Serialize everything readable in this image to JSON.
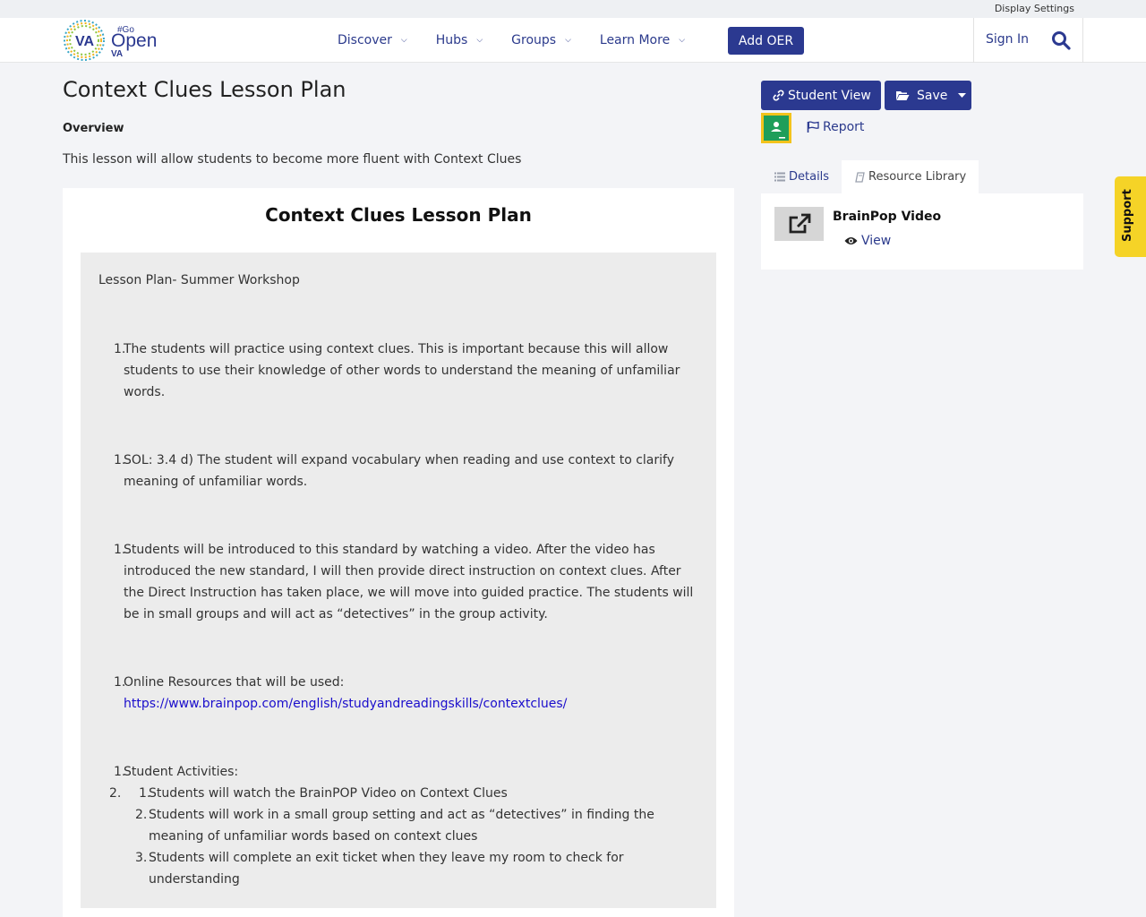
{
  "topbar": {
    "display_settings": "Display Settings"
  },
  "header": {
    "logo": {
      "text_va": "VA",
      "text_go": "#Go",
      "text_open": "Open",
      "text_va2": "VA"
    },
    "nav": [
      {
        "label": "Discover"
      },
      {
        "label": "Hubs"
      },
      {
        "label": "Groups"
      },
      {
        "label": "Learn More"
      }
    ],
    "add_oer": "Add OER",
    "sign_in": "Sign In"
  },
  "page": {
    "title": "Context Clues Lesson Plan",
    "overview_label": "Overview",
    "overview_text": "This lesson will allow students to become more fluent with Context Clues"
  },
  "content": {
    "heading": "Context Clues Lesson Plan",
    "lesson_label": "Lesson Plan- Summer Workshop",
    "items": [
      {
        "num": "1.",
        "text": "The students will practice using context clues. This is important because this will allow students to use their knowledge of other words to understand the meaning of unfamiliar words."
      },
      {
        "num": "1.",
        "text": "SOL: 3.4 d) The student will expand vocabulary when reading and use context to clarify meaning of unfamiliar words."
      },
      {
        "num": "1.",
        "text": "Students will be introduced to this standard by watching a video. After the video has introduced the new standard, I will then provide direct instruction on context clues. After the Direct Instruction has taken place, we will move into guided practice. The students will be in small groups and will act as “detectives” in the group activity."
      },
      {
        "num": "1.",
        "text": "Online Resources that will be used:",
        "link": "https://www.brainpop.com/english/studyandreadingskills/contextclues/"
      },
      {
        "num": "1.",
        "text": "Student Activities:"
      }
    ],
    "outer_num_2": "2.",
    "sub_items": [
      {
        "num": "1.",
        "text": "Students will watch the BrainPOP Video on Context Clues"
      },
      {
        "num": "2.",
        "text": "Students will work in a small group setting and act as “detectives” in finding the meaning of unfamiliar words based on context clues"
      },
      {
        "num": "3.",
        "text": "Students will complete an exit ticket when they leave my room to check for understanding"
      }
    ]
  },
  "sidebar": {
    "student_view": "Student View",
    "save": "Save",
    "report": "Report",
    "tabs": [
      {
        "label": "Details"
      },
      {
        "label": "Resource Library"
      }
    ],
    "resource": {
      "title": "BrainPop Video",
      "view": "View"
    }
  },
  "support": "Support",
  "colors": {
    "brand_blue": "#2b3990",
    "support_yellow": "#f5d327",
    "classroom_green": "#1e9e5a"
  }
}
